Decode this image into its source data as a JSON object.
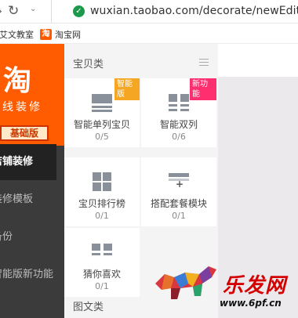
{
  "browser": {
    "url": "wuxian.taobao.com/decorate/newEdit.h",
    "bookmarks": [
      "艾文教室",
      "淘宝网"
    ]
  },
  "sidebar": {
    "brand_logo": "淘",
    "brand_sub": "无线装修",
    "edition": "基础版",
    "items": [
      {
        "label": "店铺装修",
        "active": true
      },
      {
        "label": "装修模板",
        "active": false
      },
      {
        "label": "备份",
        "active": false
      },
      {
        "label": "智能版新功能",
        "active": false
      }
    ]
  },
  "panel": {
    "title": "宝贝类",
    "tiles": [
      {
        "label": "智能单列宝贝",
        "count": "0/5",
        "badge": "智能版",
        "badge_color": "#f5a623",
        "icon": "single-column-icon"
      },
      {
        "label": "智能双列",
        "count": "0/6",
        "badge": "新功能",
        "badge_color": "#ff2e6f",
        "icon": "double-column-icon"
      },
      {
        "label": "宝贝排行榜",
        "count": "0/1",
        "badge": "",
        "icon": "ranking-grid-icon"
      },
      {
        "label": "搭配套餐模块",
        "count": "0/1",
        "badge": "",
        "icon": "combo-package-icon"
      },
      {
        "label": "猜你喜欢",
        "count": "0/1",
        "badge": "",
        "icon": "guess-like-icon"
      }
    ],
    "section2_title": "图文类"
  },
  "watermark": {
    "title": "乐发网",
    "url": "www.6pf.cn"
  },
  "colors": {
    "brand": "#ff5b00",
    "sidebar_bg": "#3b3b3b",
    "canvas_bg": "#ebe9ec"
  }
}
